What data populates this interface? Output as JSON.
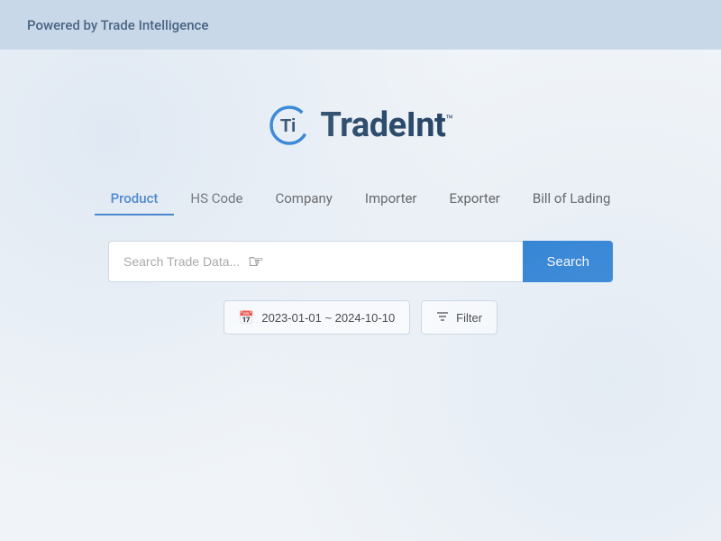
{
  "banner": {
    "text": "Powered by Trade Intelligence"
  },
  "logo": {
    "text": "TradeInt",
    "tm": "™"
  },
  "nav": {
    "tabs": [
      {
        "id": "product",
        "label": "Product",
        "active": true
      },
      {
        "id": "hs-code",
        "label": "HS Code",
        "active": false
      },
      {
        "id": "company",
        "label": "Company",
        "active": false
      },
      {
        "id": "importer",
        "label": "Importer",
        "active": false
      },
      {
        "id": "exporter",
        "label": "Exporter",
        "active": false
      },
      {
        "id": "bill-of-lading",
        "label": "Bill of Lading",
        "active": false
      }
    ]
  },
  "search": {
    "placeholder": "Search Trade Data...",
    "button_label": "Search"
  },
  "filters": {
    "date_range": "2023-01-01 ~ 2024-10-10",
    "filter_label": "Filter"
  },
  "colors": {
    "accent": "#1976d2",
    "active_tab": "#1565c0",
    "banner_bg": "#c8d8e8",
    "logo_dark": "#1a3a5c"
  }
}
